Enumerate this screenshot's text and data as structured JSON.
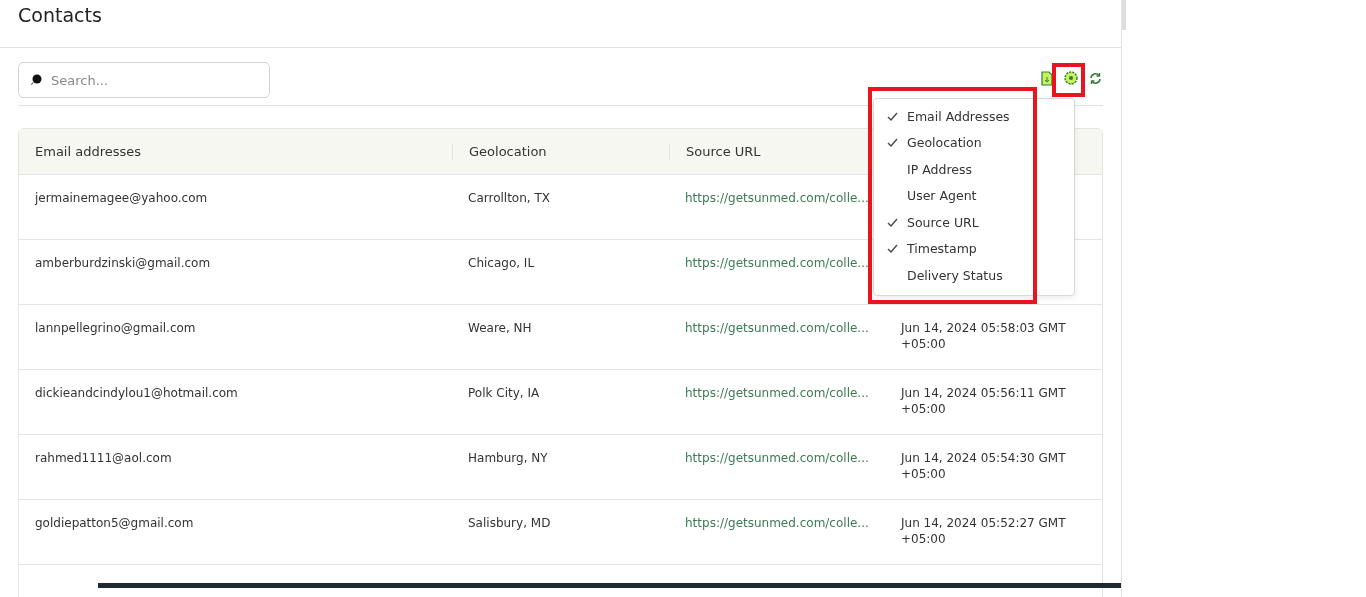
{
  "page": {
    "title": "Contacts"
  },
  "search": {
    "placeholder": "Search..."
  },
  "table": {
    "columns": [
      "Email addresses",
      "Geolocation",
      "Source URL"
    ],
    "rows": [
      {
        "email": "jermainemagee@yahoo.com",
        "location": "Carrollton, TX",
        "url": "https://getsunmed.com/colle..."
      },
      {
        "email": "amberburdzinski@gmail.com",
        "location": "Chicago, IL",
        "url": "https://getsunmed.com/colle..."
      },
      {
        "email": "lannpellegrino@gmail.com",
        "location": "Weare, NH",
        "url": "https://getsunmed.com/colle...",
        "timestamp": "Jun 14, 2024 05:58:03 GMT +05:00"
      },
      {
        "email": "dickieandcindylou1@hotmail.com",
        "location": "Polk City, IA",
        "url": "https://getsunmed.com/colle...",
        "timestamp": "Jun 14, 2024 05:56:11 GMT +05:00"
      },
      {
        "email": "rahmed1111@aol.com",
        "location": "Hamburg, NY",
        "url": "https://getsunmed.com/colle...",
        "timestamp": "Jun 14, 2024 05:54:30 GMT +05:00"
      },
      {
        "email": "goldiepatton5@gmail.com",
        "location": "Salisbury, MD",
        "url": "https://getsunmed.com/colle...",
        "timestamp": "Jun 14, 2024 05:52:27 GMT +05:00"
      }
    ]
  },
  "column_menu": {
    "items": [
      {
        "label": "Email Addresses",
        "checked": true
      },
      {
        "label": "Geolocation",
        "checked": true
      },
      {
        "label": "IP Address",
        "checked": false
      },
      {
        "label": "User Agent",
        "checked": false
      },
      {
        "label": "Source URL",
        "checked": true
      },
      {
        "label": "Timestamp",
        "checked": true
      },
      {
        "label": "Delivery Status",
        "checked": false
      }
    ]
  }
}
